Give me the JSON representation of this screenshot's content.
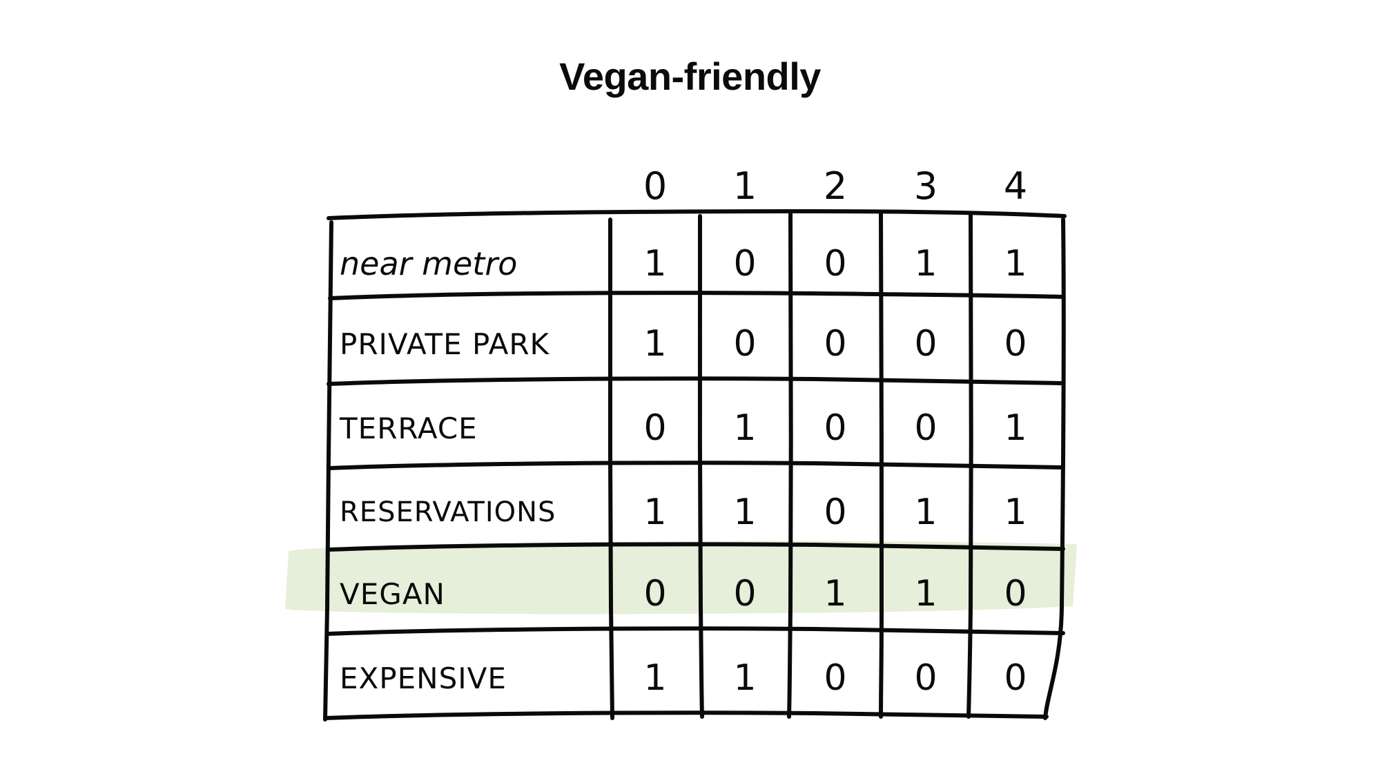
{
  "title": "Vegan-friendly",
  "highlight": {
    "row_label": "VEGAN",
    "color": "#e6efd9"
  },
  "ink_color": "#0a0a0a",
  "background": "#ffffff",
  "chart_data": {
    "type": "table",
    "title": "Vegan-friendly",
    "xlabel": "",
    "ylabel": "",
    "column_headers": [
      "0",
      "1",
      "2",
      "3",
      "4"
    ],
    "row_labels": [
      "near metro",
      "PRIVATE PARK",
      "TERRACE",
      "RESERVATIONS",
      "VEGAN",
      "EXPENSIVE"
    ],
    "rows": [
      {
        "label": "near metro",
        "values": [
          "1",
          "0",
          "0",
          "1",
          "1"
        ],
        "highlighted": false
      },
      {
        "label": "PRIVATE PARK",
        "values": [
          "1",
          "0",
          "0",
          "0",
          "0"
        ],
        "highlighted": false
      },
      {
        "label": "TERRACE",
        "values": [
          "0",
          "1",
          "0",
          "0",
          "1"
        ],
        "highlighted": false
      },
      {
        "label": "RESERVATIONS",
        "values": [
          "1",
          "1",
          "0",
          "1",
          "1"
        ],
        "highlighted": false
      },
      {
        "label": "VEGAN",
        "values": [
          "0",
          "0",
          "1",
          "1",
          "0"
        ],
        "highlighted": true
      },
      {
        "label": "EXPENSIVE",
        "values": [
          "1",
          "1",
          "0",
          "0",
          "0"
        ],
        "highlighted": false
      }
    ],
    "legend": [],
    "annotations": [
      "VEGAN row highlighted with a green marker stroke"
    ],
    "grid": true
  }
}
